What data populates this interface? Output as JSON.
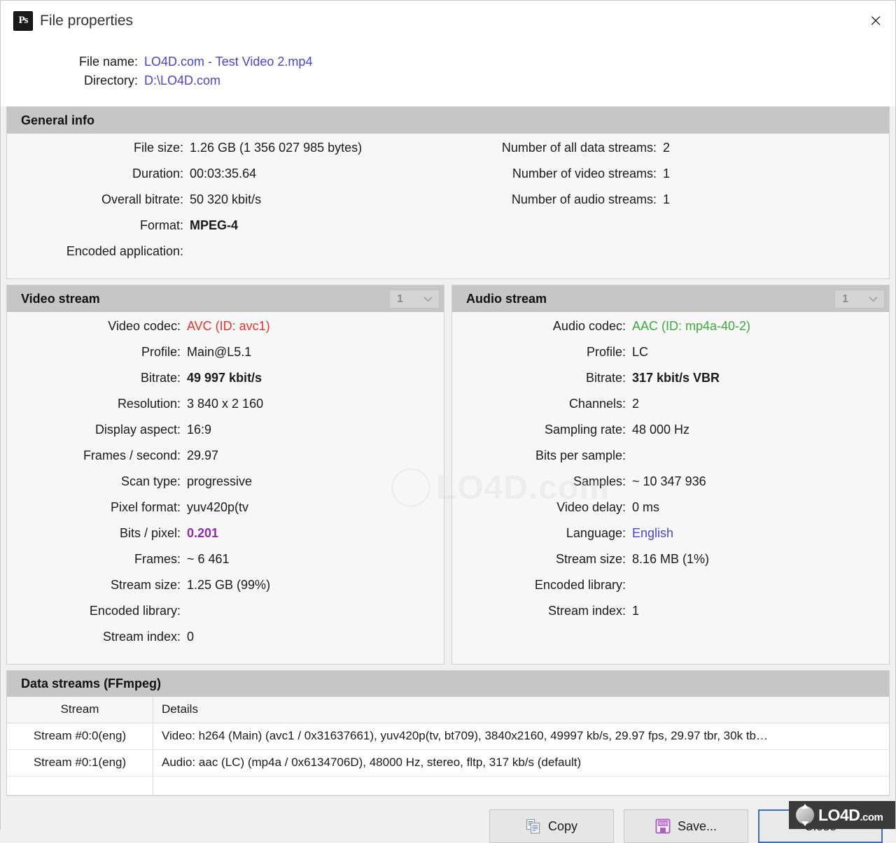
{
  "window": {
    "title": "File properties",
    "app_icon_text": "Ps",
    "close_icon": "×"
  },
  "file_header": {
    "rows": [
      {
        "label": "File name:",
        "value": "LO4D.com - Test Video 2.mp4"
      },
      {
        "label": "Directory:",
        "value": "D:\\LO4D.com"
      }
    ]
  },
  "general_info": {
    "title": "General info",
    "left": [
      {
        "label": "File size:",
        "value": "1.26 GB (1 356 027 985 bytes)"
      },
      {
        "label": "Duration:",
        "value": "00:03:35.64"
      },
      {
        "label": "Overall bitrate:",
        "value": "50 320 kbit/s"
      },
      {
        "label": "Format:",
        "value": "MPEG-4"
      },
      {
        "label": "Encoded application:",
        "value": ""
      }
    ],
    "right": [
      {
        "label": "Number of all data streams:",
        "value": "2"
      },
      {
        "label": "Number of video streams:",
        "value": "1"
      },
      {
        "label": "Number of audio streams:",
        "value": "1"
      }
    ]
  },
  "video_stream": {
    "title": "Video stream",
    "selector_value": "1",
    "chevron": "⌄",
    "rows": [
      {
        "label": "Video codec:",
        "value": "AVC (ID: avc1)"
      },
      {
        "label": "Profile:",
        "value": "Main@L5.1"
      },
      {
        "label": "Bitrate:",
        "value": "49 997 kbit/s"
      },
      {
        "label": "Resolution:",
        "value": "3 840 x 2 160"
      },
      {
        "label": "Display aspect:",
        "value": "16:9"
      },
      {
        "label": "Frames / second:",
        "value": "29.97"
      },
      {
        "label": "Scan type:",
        "value": "progressive"
      },
      {
        "label": "Pixel format:",
        "value": "yuv420p(tv"
      },
      {
        "label": "Bits / pixel:",
        "value": "0.201"
      },
      {
        "label": "Frames:",
        "value": "~ 6 461"
      },
      {
        "label": "Stream size:",
        "value": "1.25 GB (99%)"
      },
      {
        "label": "Encoded library:",
        "value": ""
      },
      {
        "label": "Stream index:",
        "value": "0"
      }
    ]
  },
  "audio_stream": {
    "title": "Audio stream",
    "selector_value": "1",
    "chevron": "⌄",
    "rows": [
      {
        "label": "Audio codec:",
        "value": "AAC (ID: mp4a-40-2)"
      },
      {
        "label": "Profile:",
        "value": "LC"
      },
      {
        "label": "Bitrate:",
        "value": "317 kbit/s  VBR"
      },
      {
        "label": "Channels:",
        "value": "2"
      },
      {
        "label": "Sampling rate:",
        "value": "48 000 Hz"
      },
      {
        "label": "Bits per sample:",
        "value": ""
      },
      {
        "label": "Samples:",
        "value": "~ 10 347 936"
      },
      {
        "label": "Video delay:",
        "value": "0 ms"
      },
      {
        "label": "Language:",
        "value": "English"
      },
      {
        "label": "Stream size:",
        "value": "8.16 MB (1%)"
      },
      {
        "label": "Encoded library:",
        "value": ""
      },
      {
        "label": "Stream index:",
        "value": "1"
      }
    ]
  },
  "data_streams": {
    "title": "Data streams   (FFmpeg)",
    "columns": [
      "Stream",
      "Details"
    ],
    "rows": [
      {
        "stream": "Stream #0:0(eng)",
        "details": "Video: h264 (Main) (avc1 / 0x31637661), yuv420p(tv, bt709), 3840x2160, 49997 kb/s, 29.97 fps, 29.97 tbr, 30k tb…"
      },
      {
        "stream": "Stream #0:1(eng)",
        "details": "Audio: aac (LC) (mp4a / 0x6134706D), 48000 Hz, stereo, fltp, 317 kb/s (default)"
      }
    ]
  },
  "footer": {
    "copy_label": "Copy",
    "save_label": "Save...",
    "close_label": "Close"
  },
  "watermarks": {
    "text": "LO4D.com",
    "badge_main": "LO4D",
    "badge_suffix": ".com"
  }
}
